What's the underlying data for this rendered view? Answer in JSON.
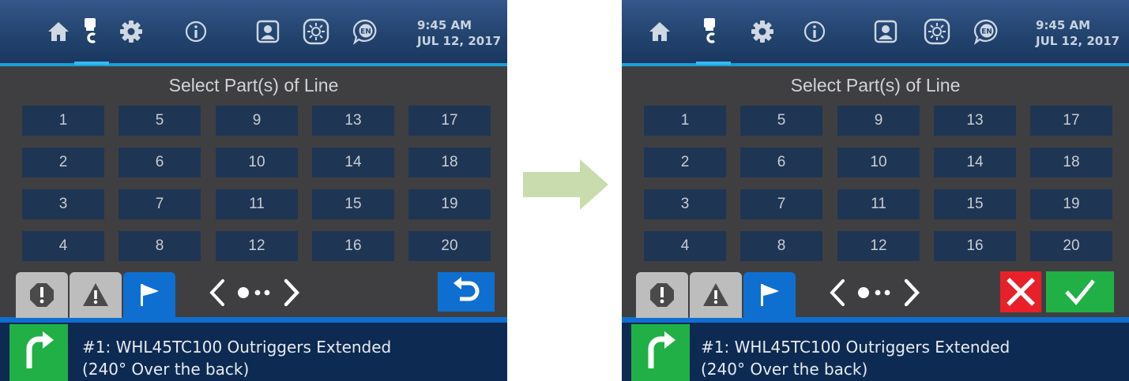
{
  "header": {
    "time": "9:45 AM",
    "date": "JUL 12, 2017",
    "language_badge": "EN",
    "icons": [
      "home-icon",
      "crane-hook-icon",
      "gear-icon",
      "info-icon",
      "operator-icon",
      "brightness-icon",
      "language-icon"
    ]
  },
  "title": "Select Part(s) of Line",
  "parts": [
    "1",
    "2",
    "3",
    "4",
    "5",
    "6",
    "7",
    "8",
    "9",
    "10",
    "11",
    "12",
    "13",
    "14",
    "15",
    "16",
    "17",
    "18",
    "19",
    "20"
  ],
  "tabs": [
    "stop-alert-icon",
    "warning-icon",
    "flag-icon"
  ],
  "message": {
    "line1": "#1: WHL45TC100 Outriggers Extended",
    "line2": "(240° Over the back)"
  },
  "colors": {
    "topbar": "#23446f",
    "accent": "#1aa0d8",
    "grid_button": "#1f3554",
    "background": "#3f3f41",
    "confirm_green": "#20b046",
    "cancel_red": "#e8202a",
    "tab_blue": "#0f6fd0",
    "transition_arrow": "#c9dcae"
  }
}
